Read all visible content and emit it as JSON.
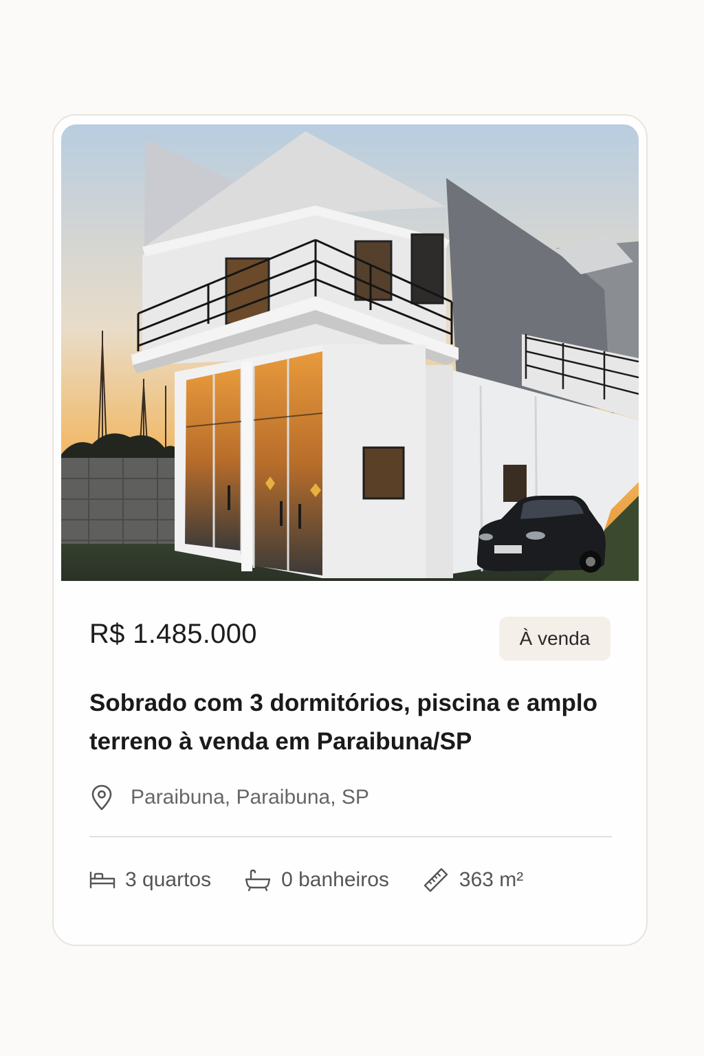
{
  "listing": {
    "price": "R$ 1.485.000",
    "status_badge": "À venda",
    "title": "Sobrado com 3 dormitórios, piscina e amplo terreno à venda em Paraibuna/SP",
    "location": "Paraibuna, Paraibuna, SP",
    "features": {
      "bedrooms": "3 quartos",
      "bathrooms": "0 banheiros",
      "area": "363 m²"
    },
    "icons": {
      "location": "map-pin-icon",
      "bedrooms": "bed-icon",
      "bathrooms": "bathtub-icon",
      "area": "ruler-icon"
    }
  },
  "colors": {
    "page_background": "#fbfaf8",
    "card_background": "#fefefe",
    "card_border": "#e8e4de",
    "badge_background": "#f4efe9",
    "text_primary": "#1a1a1a",
    "text_secondary": "#666666"
  }
}
